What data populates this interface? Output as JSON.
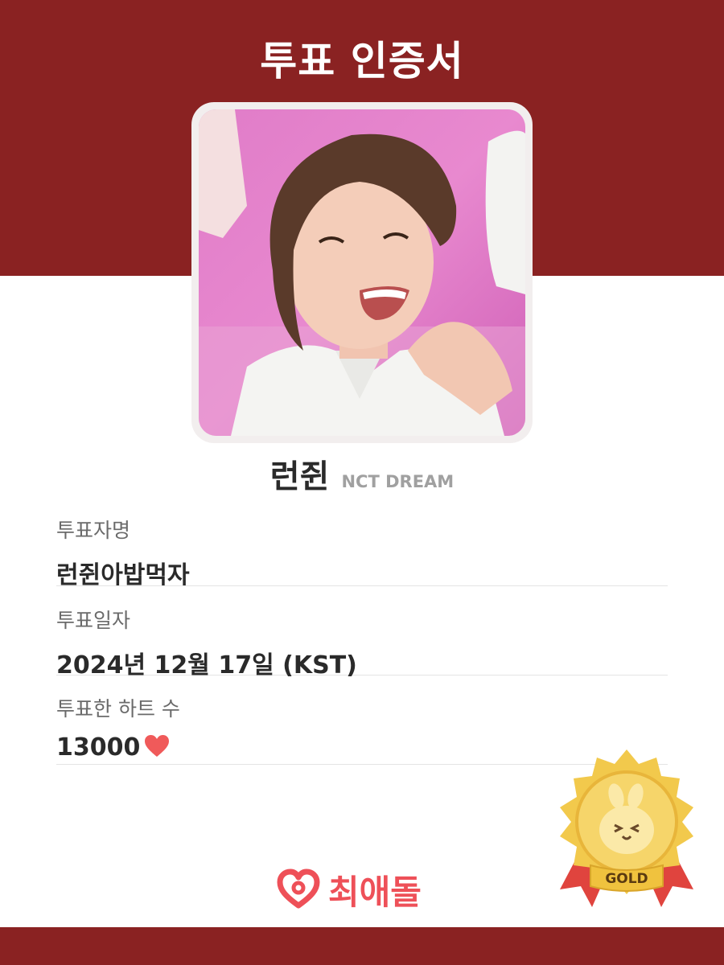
{
  "header": {
    "title": "투표 인증서"
  },
  "idol": {
    "name": "런쥔",
    "group": "NCT DREAM"
  },
  "fields": [
    {
      "label": "투표자명",
      "value": "런쥔아밥먹자"
    },
    {
      "label": "투표일자",
      "value": "2024년 12월 17일 (KST)"
    },
    {
      "label": "투표한 하트 수",
      "value": "13000"
    }
  ],
  "brand": {
    "name": "최애돌"
  },
  "badge": {
    "label": "GOLD"
  },
  "colors": {
    "band": "#8a2222",
    "accent": "#ee5058",
    "heart": "#f05a5a",
    "gold": "#f2c94c"
  }
}
